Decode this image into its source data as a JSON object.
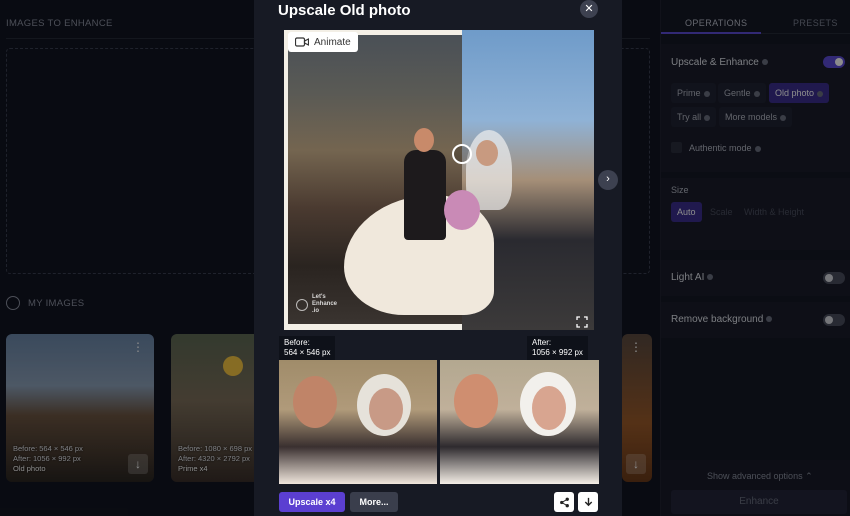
{
  "background": {
    "images_to_enhance_label": "IMAGES TO ENHANCE",
    "my_images_label": "MY IMAGES",
    "thumbnails": [
      {
        "before": "Before: 564 × 546 px",
        "after": "After:   1056 × 992 px",
        "model": "Old photo"
      },
      {
        "before": "Before: 1080 × 698 px",
        "after": "After:   4320 × 2792 px",
        "model": "Prime x4"
      }
    ]
  },
  "right_panel": {
    "tabs": [
      "OPERATIONS",
      "PRESETS"
    ],
    "upscale_title": "Upscale & Enhance",
    "upscale_models": [
      "Prime",
      "Gentle",
      "Old photo",
      "Try all",
      "More models"
    ],
    "active_model": "Old photo",
    "authentic_mode": "Authentic mode",
    "size_label": "Size",
    "size_options": [
      "Auto",
      "Scale",
      "Width & Height"
    ],
    "light_ai": "Light AI",
    "remove_background": "Remove background",
    "advanced": "Show advanced options",
    "advanced_caret": "⌃",
    "enhance": "Enhance"
  },
  "modal": {
    "title": "Upscale Old photo",
    "close_glyph": "✕",
    "animate_label": "Animate",
    "watermark_line1": "Let's",
    "watermark_line2": "Enhance",
    "watermark_line3": ".io",
    "next_glyph": "›",
    "before_label": "Before:",
    "before_size": "564 × 546 px",
    "after_label": "After:",
    "after_size": "1056 × 992 px",
    "upscale_button": "Upscale x4",
    "more_button": "More..."
  },
  "icons": {
    "camera": "camera-icon",
    "share": "share-icon",
    "download": "download-icon",
    "expand": "expand-icon"
  },
  "colors": {
    "accent": "#5b3fd1",
    "active_chip": "#3b2f8e",
    "toggle_on": "#5b4bd6"
  }
}
